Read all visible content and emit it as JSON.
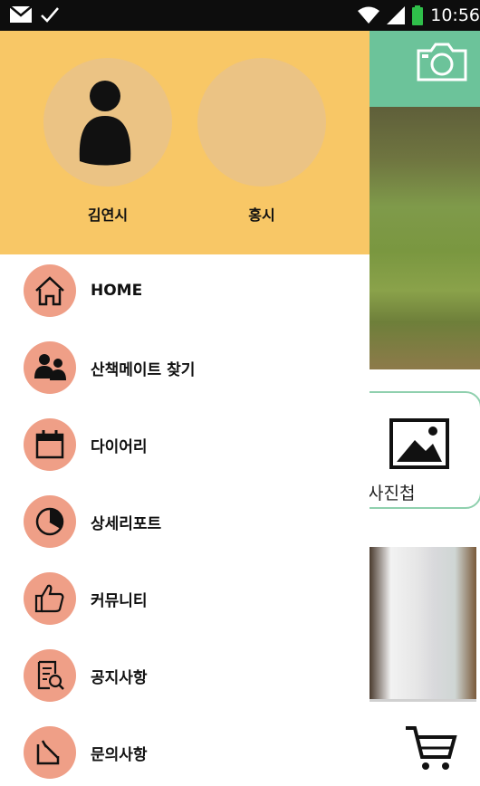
{
  "status_bar": {
    "time": "10:56",
    "left_icons": [
      "mail-icon",
      "check-icon"
    ],
    "right_icons": [
      "wifi-icon",
      "signal-icon",
      "battery-icon"
    ]
  },
  "drawer": {
    "header_color": "#f8c766",
    "profiles": [
      {
        "name": "김연시",
        "avatar": "person-icon"
      },
      {
        "name": "홍시",
        "avatar": "empty"
      }
    ],
    "menu_color": "#ef9f87",
    "menu": [
      {
        "label": "HOME",
        "icon": "home-icon"
      },
      {
        "label": "산책메이트 찾기",
        "icon": "people-icon"
      },
      {
        "label": "다이어리",
        "icon": "calendar-icon"
      },
      {
        "label": "상세리포트",
        "icon": "pie-chart-icon"
      },
      {
        "label": "커뮤니티",
        "icon": "thumbs-up-icon"
      },
      {
        "label": "공지사항",
        "icon": "notice-icon"
      },
      {
        "label": "문의사항",
        "icon": "inquiry-icon"
      }
    ]
  },
  "background_app": {
    "accent": "#6cc39a",
    "album_label": "사진첩",
    "icons": [
      "camera-icon",
      "image-icon",
      "cart-icon"
    ]
  }
}
